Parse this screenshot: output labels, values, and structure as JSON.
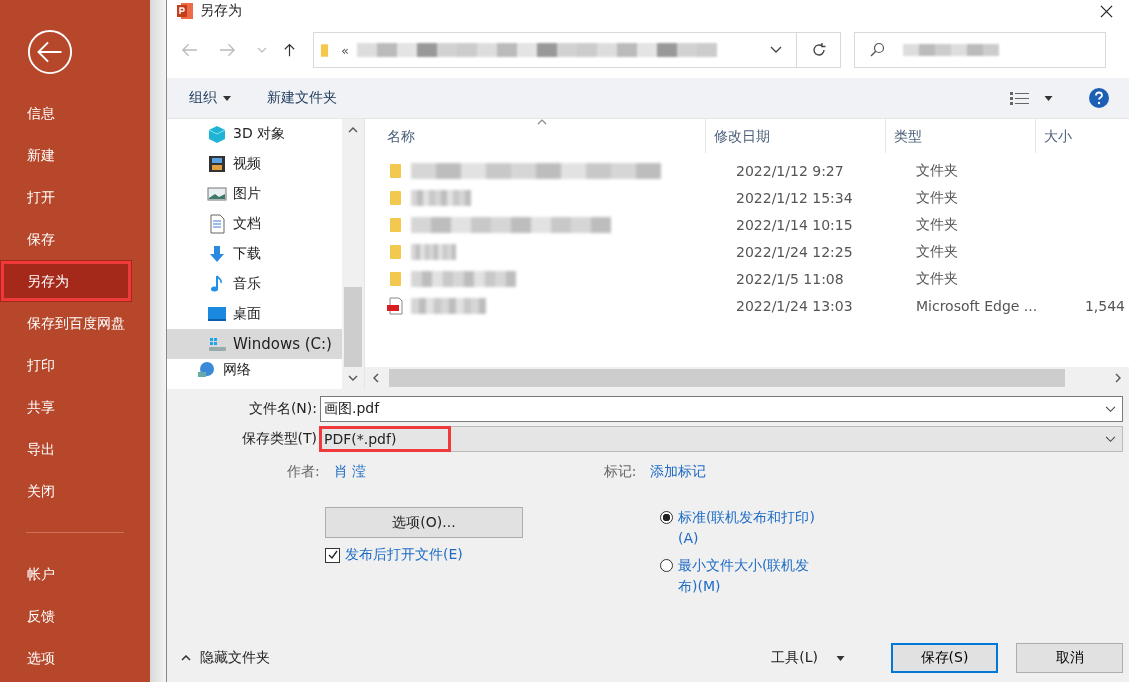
{
  "sidebar": {
    "items": [
      {
        "label": "信息",
        "selected": false,
        "annotated": false
      },
      {
        "label": "新建",
        "selected": false,
        "annotated": false
      },
      {
        "label": "打开",
        "selected": false,
        "annotated": false
      },
      {
        "label": "保存",
        "selected": false,
        "annotated": false
      },
      {
        "label": "另存为",
        "selected": true,
        "annotated": true
      },
      {
        "label": "保存到百度网盘",
        "selected": false,
        "annotated": false
      },
      {
        "label": "打印",
        "selected": false,
        "annotated": false
      },
      {
        "label": "共享",
        "selected": false,
        "annotated": false
      },
      {
        "label": "导出",
        "selected": false,
        "annotated": false
      },
      {
        "label": "关闭",
        "selected": false,
        "annotated": false
      }
    ],
    "bottom_items": [
      {
        "label": "帐户",
        "selected": false
      },
      {
        "label": "反馈",
        "selected": false
      },
      {
        "label": "选项",
        "selected": false
      }
    ]
  },
  "dialog": {
    "title": "另存为",
    "address": {
      "prefix": "«"
    },
    "toolbar": {
      "organize": "组织",
      "new_folder": "新建文件夹"
    },
    "nav_items": [
      {
        "label": "3D 对象",
        "kind": "cube",
        "selected": false
      },
      {
        "label": "视频",
        "kind": "film",
        "selected": false
      },
      {
        "label": "图片",
        "kind": "image",
        "selected": false
      },
      {
        "label": "文档",
        "kind": "doc",
        "selected": false
      },
      {
        "label": "下载",
        "kind": "download",
        "selected": false
      },
      {
        "label": "音乐",
        "kind": "music",
        "selected": false
      },
      {
        "label": "桌面",
        "kind": "desktop",
        "selected": false
      },
      {
        "label": "Windows (C:)",
        "kind": "drive",
        "selected": true
      },
      {
        "label": "网络",
        "kind": "network",
        "selected": false
      }
    ],
    "columns": [
      "名称",
      "修改日期",
      "类型",
      "大小"
    ],
    "rows": [
      {
        "kind": "folder",
        "modified": "2022/1/12 9:27",
        "type": "文件夹"
      },
      {
        "kind": "folder",
        "modified": "2022/1/12 15:34",
        "type": "文件夹"
      },
      {
        "kind": "folder",
        "modified": "2022/1/14 10:15",
        "type": "文件夹"
      },
      {
        "kind": "folder",
        "modified": "2022/1/24 12:25",
        "type": "文件夹"
      },
      {
        "kind": "folder",
        "modified": "2022/1/5 11:08",
        "type": "文件夹"
      },
      {
        "kind": "pdf",
        "modified": "2022/1/24 13:03",
        "type": "Microsoft Edge ...",
        "size": "1,544"
      }
    ],
    "form": {
      "filename_label": "文件名(N):",
      "filename": "画图.pdf",
      "type_label": "保存类型(T)",
      "file_type": "PDF(*.pdf)",
      "file_type_annotated": true,
      "author_label": "作者:",
      "author": "肖 滢",
      "tags_label": "标记:",
      "tags": "添加标记",
      "options_button": "选项(O)...",
      "open_after": {
        "label": "发布后打开文件(E)",
        "checked": true
      },
      "radios": [
        {
          "label": "标准(联机发布和打印)(A)",
          "selected": true
        },
        {
          "label": "最小文件大小(联机发布)(M)",
          "selected": false
        }
      ]
    },
    "footer": {
      "hide_folders": "隐藏文件夹",
      "tools": "工具(L)",
      "save": "保存(S)",
      "cancel": "取消"
    }
  }
}
